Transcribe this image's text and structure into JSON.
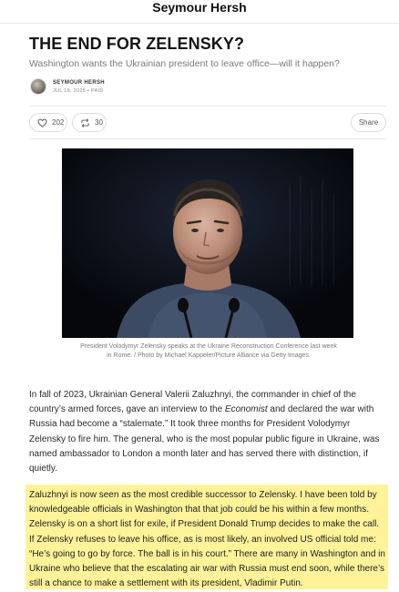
{
  "header": {
    "publication": "Seymour Hersh"
  },
  "post": {
    "title": "THE END FOR ZELENSKY?",
    "subtitle": "Washington wants the Ukrainian president to leave office—will it happen?",
    "author": "SEYMOUR HERSH",
    "date": "JUL 18, 2025",
    "paid_badge": "PAID",
    "meta_separator": "•"
  },
  "actions": {
    "likes": "202",
    "restacks": "30",
    "share_label": "Share"
  },
  "image": {
    "caption": "President Volodymyr Zelensky speaks at the Ukraine Reconstruction Conference last week in Rome. / Photo by Michael Kappeler/Picture Alliance via Getty Images."
  },
  "body": {
    "p1_before": "In fall of 2023, Ukrainian General Valerii Zaluzhnyi, the commander in chief of the country’s armed forces, gave an interview to the ",
    "p1_em": "Economist",
    "p1_after": " and declared the war with Russia had become a “stalemate.” It took three months for President Volodymyr Zelensky to fire him. The general, who is the most popular public figure in Ukraine, was named ambassador to London a month later and has served there with distinction, if quietly.",
    "p2": "Zaluzhnyi is now seen as the most credible successor to Zelensky. I have been told by knowledgeable officials in Washington that that job could be his within a few months. Zelensky is on a short list for exile, if President Donald Trump decides to make the call. If Zelensky refuses to leave his office, as is most likely, an involved US official told me: “He’s going to go by force. The ball is in his court.” There are many in Washington and in Ukraine who believe that the escalating air war with Russia must end soon, while there’s still a chance to make a settlement with its president, Vladimir Putin."
  },
  "colors": {
    "highlight": "#fff39a",
    "text": "#2a2a2a",
    "muted": "#7a7a7a"
  }
}
